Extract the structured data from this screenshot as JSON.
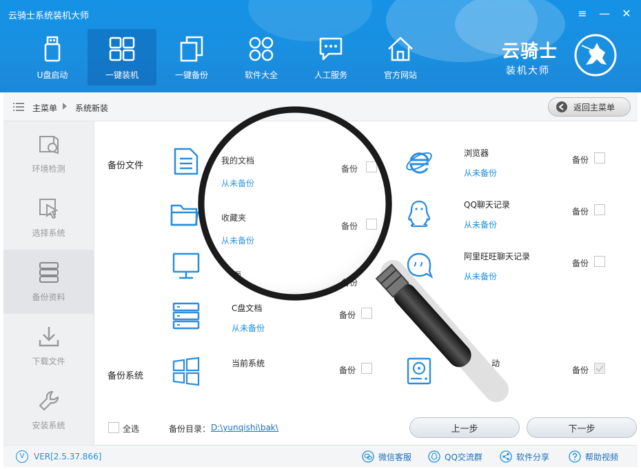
{
  "app": {
    "title": "云骑士系统装机大师"
  },
  "window_controls": {
    "menu": "≡",
    "minimize": "—",
    "close": "✕"
  },
  "nav": [
    {
      "label": "U盘启动",
      "icon": "usb-icon"
    },
    {
      "label": "一键装机",
      "icon": "windows-icon",
      "active": true
    },
    {
      "label": "一键备份",
      "icon": "copy-icon"
    },
    {
      "label": "软件大全",
      "icon": "apps-icon"
    },
    {
      "label": "人工服务",
      "icon": "chat-icon"
    },
    {
      "label": "官方网站",
      "icon": "home-icon"
    }
  ],
  "logo": {
    "line1": "云骑士",
    "line2": "装机大师"
  },
  "breadcrumb": {
    "root": "主菜单",
    "current": "系统新装",
    "back_label": "返回主菜单"
  },
  "sidebar": [
    {
      "label": "环境检测",
      "icon": "env-check-icon"
    },
    {
      "label": "选择系统",
      "icon": "cursor-select-icon"
    },
    {
      "label": "备份资料",
      "icon": "database-icon",
      "active": true
    },
    {
      "label": "下载文件",
      "icon": "download-icon"
    },
    {
      "label": "安装系统",
      "icon": "wrench-icon"
    }
  ],
  "backup": {
    "files_title": "备份文件",
    "system_title": "备份系统",
    "backup_label": "备份",
    "items_left": [
      {
        "name": "我的文档",
        "status": "从未备份",
        "icon": "document-icon"
      },
      {
        "name": "收藏夹",
        "status": "从未备份",
        "icon": "folder-icon"
      },
      {
        "name": "面",
        "status": "",
        "icon": "desktop-icon"
      },
      {
        "name": "C盘文档",
        "status": "从未备份",
        "icon": "server-icon"
      }
    ],
    "items_right": [
      {
        "name": "浏览器",
        "status": "从未备份",
        "icon": "ie-icon"
      },
      {
        "name": "QQ聊天记录",
        "status": "从未备份",
        "icon": "qq-icon"
      },
      {
        "name": "阿里旺旺聊天记录",
        "status": "从未备份",
        "icon": "wangwang-icon"
      }
    ],
    "system_item": {
      "name": "当前系统",
      "icon": "windows-icon"
    },
    "system_right": {
      "name": "动",
      "icon": "harddisk-icon"
    }
  },
  "bottom": {
    "select_all": "全选",
    "dir_label": "备份目录：",
    "dir_path": "D:\\yunqishi\\bak\\",
    "prev": "上一步",
    "next": "下一步"
  },
  "footer": {
    "version": "VER[2.5.37.866]",
    "links": [
      {
        "label": "微信客服",
        "icon": "wechat-icon"
      },
      {
        "label": "QQ交流群",
        "icon": "qq-group-icon"
      },
      {
        "label": "软件分享",
        "icon": "share-icon"
      },
      {
        "label": "帮助视频",
        "icon": "help-icon"
      }
    ]
  },
  "colors": {
    "header_blue": "#1592e6",
    "link_blue": "#1a8fe0",
    "icon_blue": "#2a8ddd"
  }
}
